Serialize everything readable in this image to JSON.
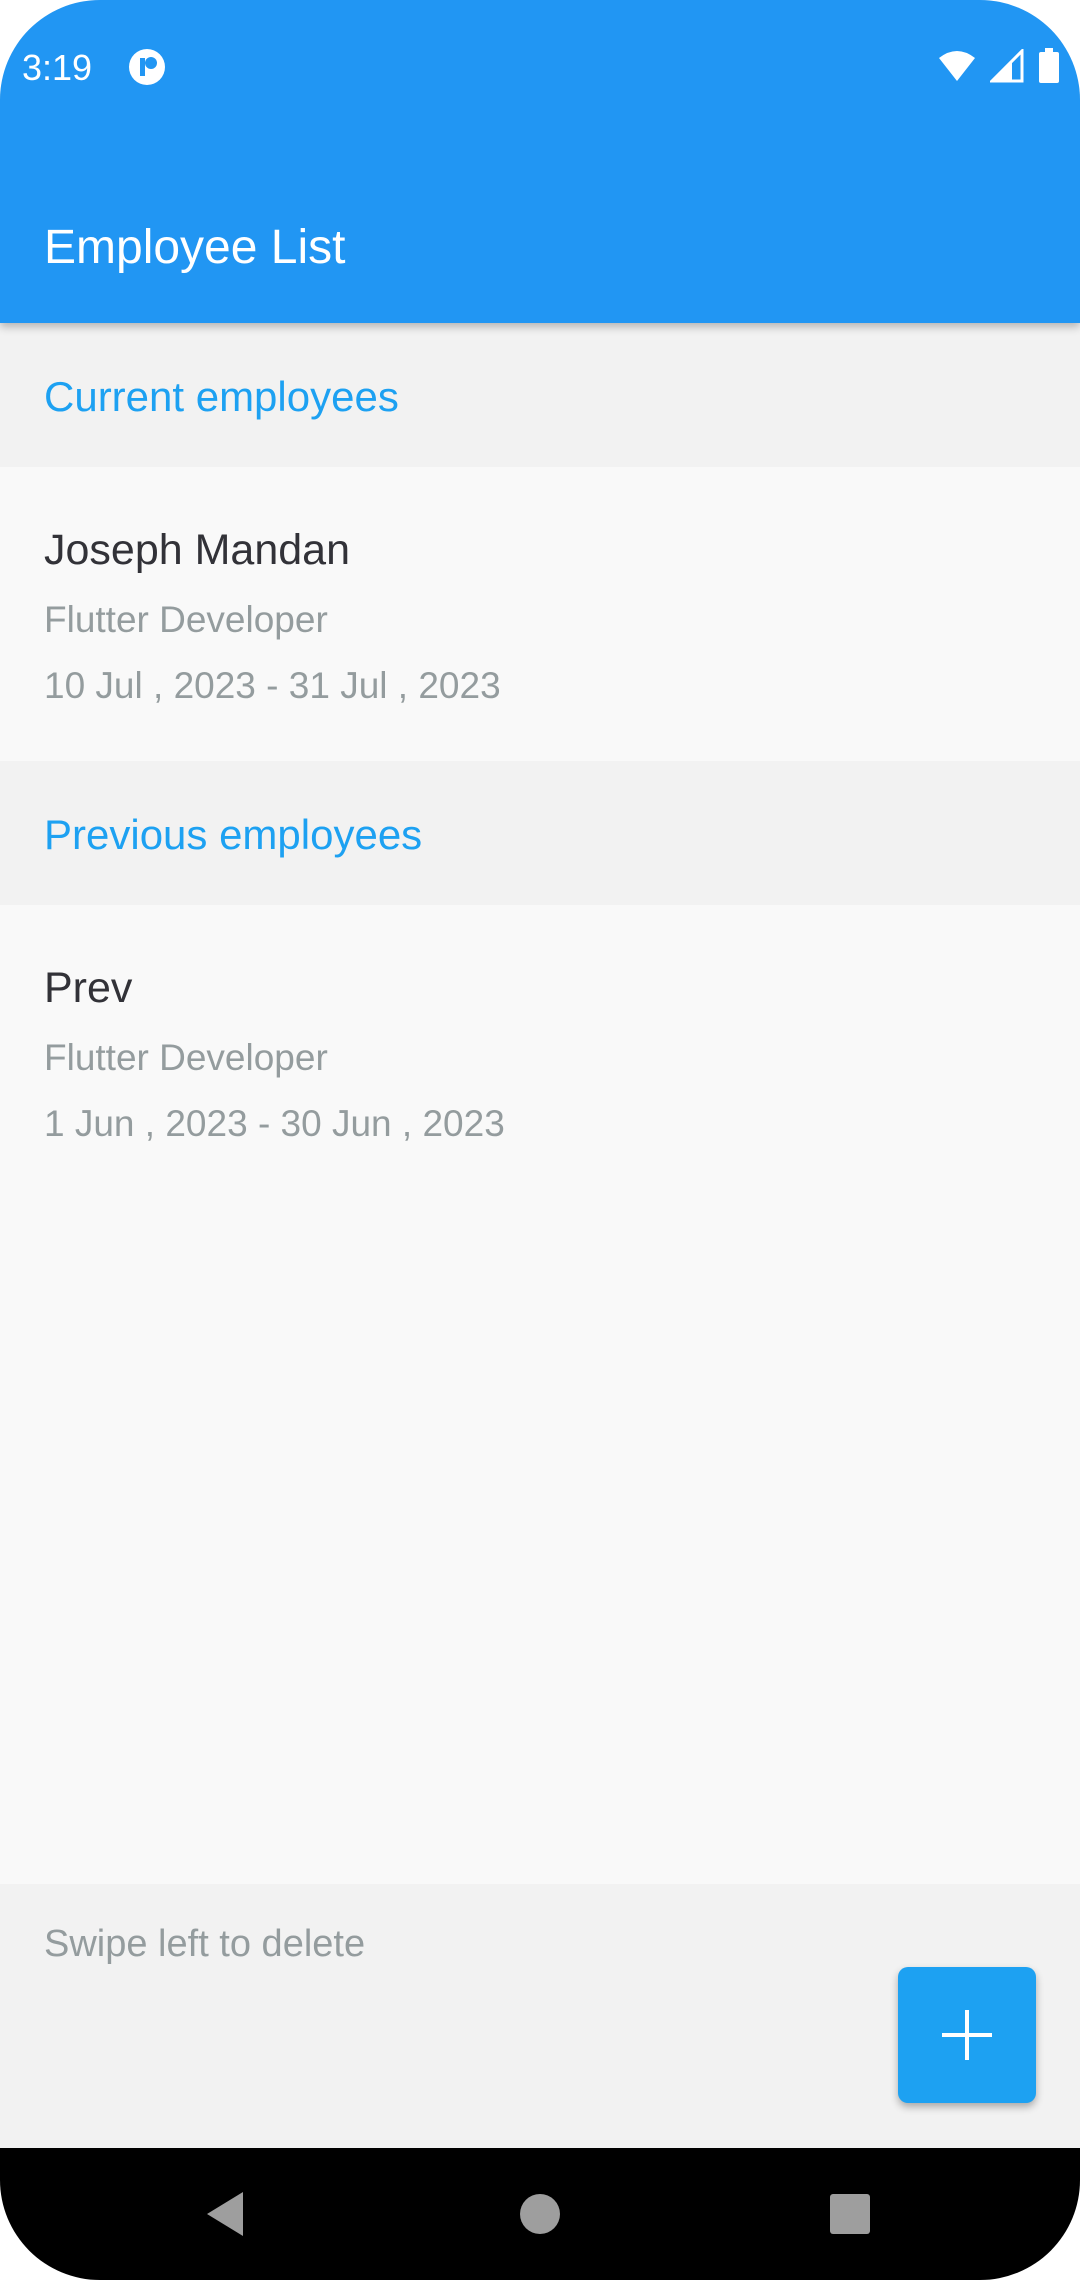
{
  "status_bar": {
    "time": "3:19"
  },
  "app_bar": {
    "title": "Employee List",
    "color": "#2196f3"
  },
  "sections": {
    "current": {
      "header": "Current employees",
      "employees": [
        {
          "name": "Joseph Mandan",
          "role": "Flutter Developer",
          "dates": "10 Jul , 2023 - 31 Jul , 2023"
        }
      ]
    },
    "previous": {
      "header": "Previous employees",
      "employees": [
        {
          "name": "Prev",
          "role": "Flutter Developer",
          "dates": "1 Jun , 2023 - 30 Jun , 2023"
        }
      ]
    }
  },
  "footer": {
    "hint": "Swipe left to delete"
  },
  "fab": {
    "icon": "plus-icon",
    "color": "#1da1f2"
  },
  "nav": {
    "back_icon": "back-icon",
    "home_icon": "home-icon",
    "recents_icon": "recents-icon"
  },
  "colors": {
    "accent": "#1da1f2",
    "primary_text": "#323238",
    "secondary_text": "#949c9e",
    "section_bg": "#f2f2f2",
    "list_bg": "#f9f9f9"
  }
}
